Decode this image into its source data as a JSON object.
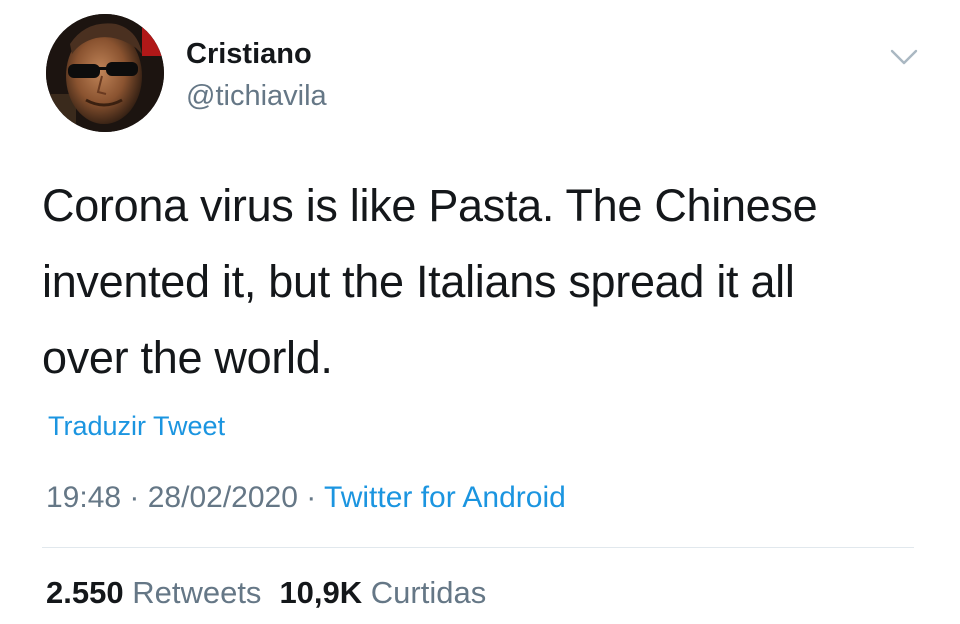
{
  "user": {
    "display_name": "Cristiano",
    "handle": "@tichiavila",
    "avatar_icon": "profile-photo"
  },
  "menu": {
    "icon": "chevron-down-icon"
  },
  "tweet": {
    "lines": [
      "Corona virus is like Pasta. The Chinese",
      "invented it, but the Italians spread it all",
      "over the world."
    ],
    "translate_label": "Traduzir Tweet"
  },
  "meta": {
    "time": "19:48",
    "separator1": " · ",
    "date": "28/02/2020",
    "separator2": " · ",
    "source": "Twitter for Android"
  },
  "stats": {
    "retweets_count": "2.550",
    "retweets_label": "Retweets",
    "likes_count": "10,9K",
    "likes_label": "Curtidas"
  },
  "colors": {
    "link": "#1b95e0",
    "secondary_text": "#657786",
    "primary_text": "#14171a",
    "divider": "#e1e8ed"
  }
}
